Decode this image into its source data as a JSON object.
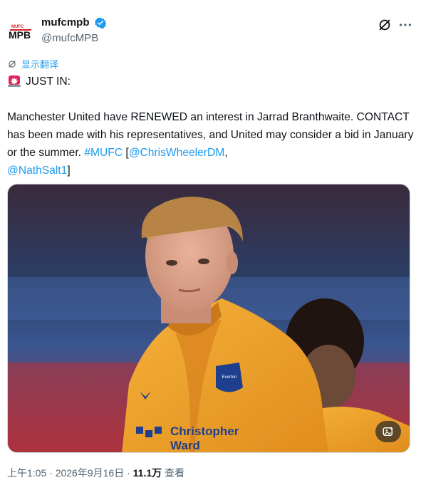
{
  "author": {
    "display_name": "mufcmpb",
    "handle": "@mufcMPB",
    "avatar_text": "MPB",
    "avatar_small_text": "MUFC"
  },
  "translate_label": "显示翻译",
  "tweet": {
    "line1": "JUST IN:",
    "body_part1": "Manchester United have RENEWED an interest in Jarrad Branthwaite. CONTACT has been made with his representatives, and United may consider a bid in January or the summer. ",
    "hashtag": "#MUFC",
    "bracket_open": " [",
    "mention1": "@ChrisWheelerDM",
    "comma": ",",
    "mention2": "@NathSalt1",
    "bracket_close": "]"
  },
  "image": {
    "sponsor_line1": "Christopher",
    "sponsor_line2": "Ward",
    "badge_text": "Everton"
  },
  "meta": {
    "time": "上午1:05",
    "sep1": " · ",
    "date": "2026年9月16日",
    "sep2": " · ",
    "views_count": "11.1万",
    "views_label": " 查看"
  },
  "colors": {
    "link": "#1d9bf0",
    "verified": "#1d9bf0",
    "secondary_text": "#536471",
    "shirt": "#f2a326"
  },
  "icons": [
    "verified-badge-icon",
    "grok-icon",
    "more-icon",
    "translate-icon",
    "siren-emoji-icon",
    "alt-image-icon"
  ]
}
